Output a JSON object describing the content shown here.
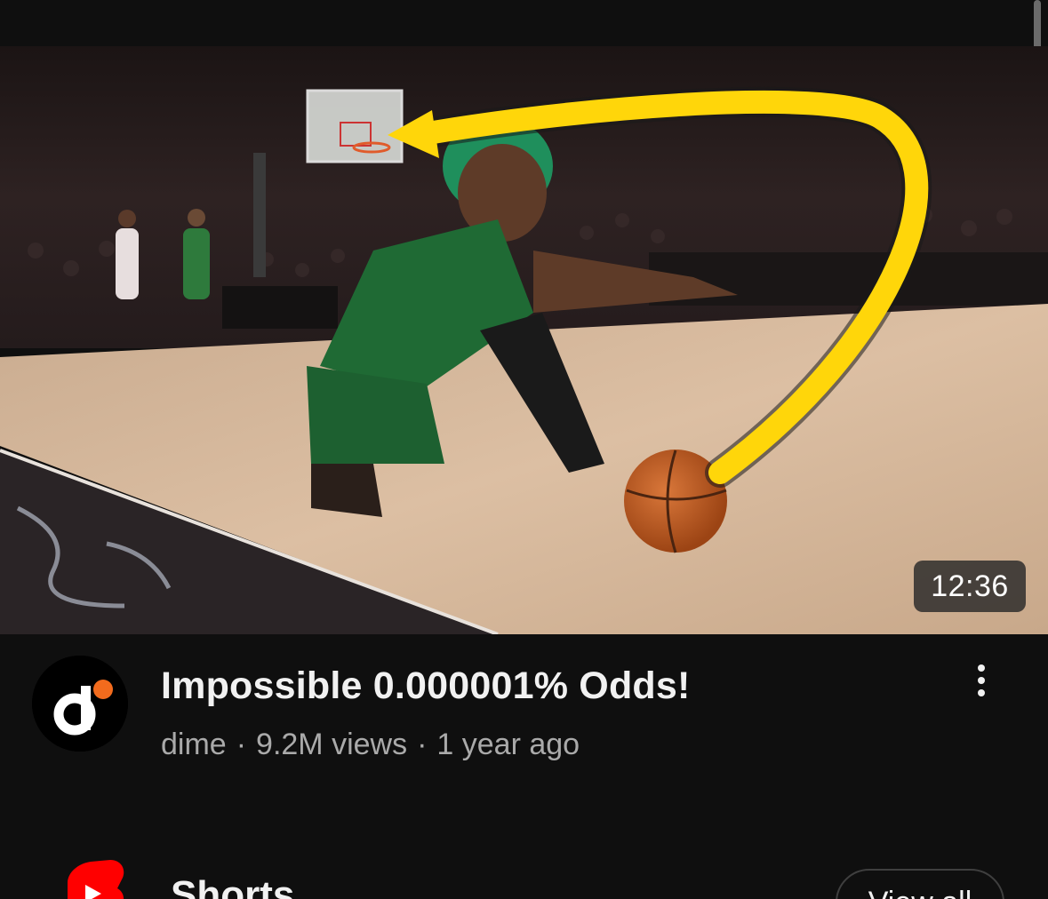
{
  "video": {
    "duration": "12:36",
    "title": "Impossible 0.000001% Odds!",
    "channel": "dime",
    "views": "9.2M views",
    "age": "1 year ago",
    "separator": "·"
  },
  "shorts": {
    "title": "Shorts",
    "view_all_label": "View all"
  },
  "colors": {
    "background": "#0f0f0f",
    "title_text": "#f1f1f1",
    "secondary_text": "#aaaaaa",
    "arrow_yellow": "#ffd60a",
    "avatar_orange": "#f26b1d",
    "shorts_red": "#ff0000"
  },
  "icons": {
    "more": "three-dot-vertical-icon",
    "shorts": "youtube-shorts-icon",
    "avatar": "dime-logo"
  }
}
